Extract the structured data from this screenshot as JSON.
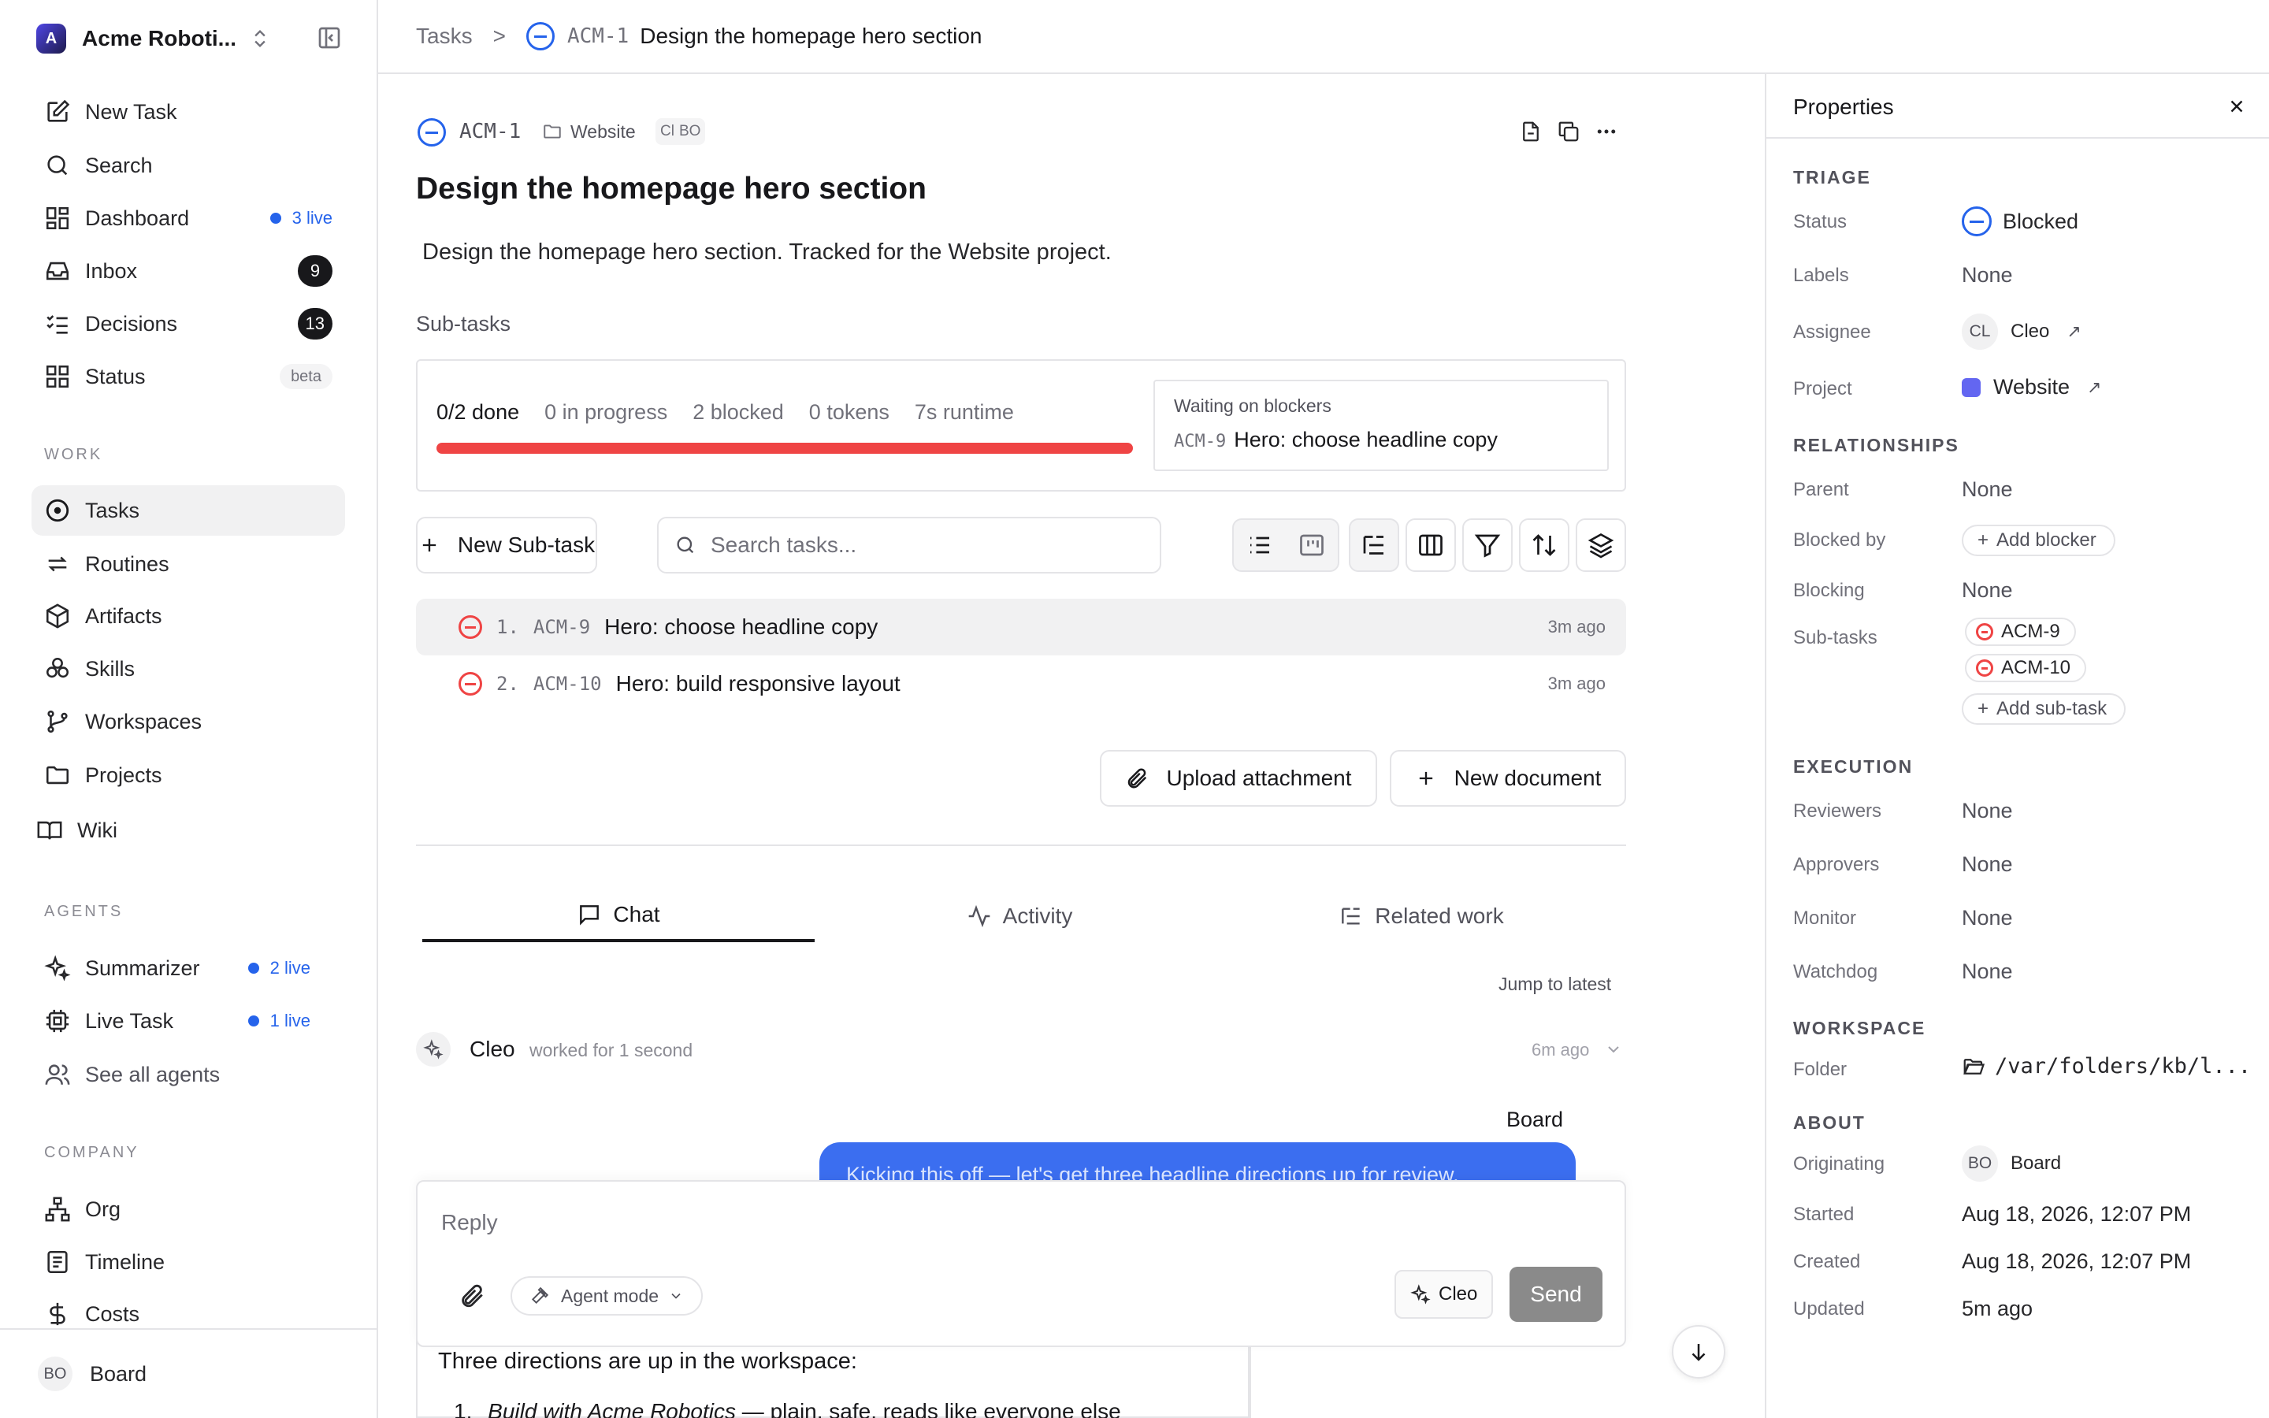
{
  "sidebar": {
    "workspace_initial": "A",
    "workspace_name": "Acme Roboti...",
    "items": [
      {
        "label": "New Task"
      },
      {
        "label": "Search"
      },
      {
        "label": "Dashboard",
        "live": "3 live"
      },
      {
        "label": "Inbox",
        "count": "9"
      },
      {
        "label": "Decisions",
        "count": "13"
      },
      {
        "label": "Status",
        "badge": "beta"
      }
    ],
    "work_label": "WORK",
    "work_items": [
      "Tasks",
      "Routines",
      "Artifacts",
      "Skills",
      "Workspaces",
      "Projects",
      "Wiki"
    ],
    "agents_label": "AGENTS",
    "agent_items": [
      {
        "label": "Summarizer",
        "live": "2 live"
      },
      {
        "label": "Live Task",
        "live": "1 live"
      },
      {
        "label": "See all agents"
      }
    ],
    "company_label": "COMPANY",
    "company_items": [
      "Org",
      "Timeline",
      "Costs"
    ],
    "user_initials": "BO",
    "user_name": "Board"
  },
  "breadcrumb": {
    "root": "Tasks",
    "sep": ">",
    "task_id": "ACM-1",
    "task_title": "Design the homepage hero section"
  },
  "task": {
    "id": "ACM-1",
    "project": "Website",
    "assignee_initials": "Cl",
    "owner_initials": "BO",
    "title": "Design the homepage hero section",
    "description": "Design the homepage hero section. Tracked for the Website project."
  },
  "subtasks": {
    "heading": "Sub-tasks",
    "stats": {
      "done": "0/2 done",
      "in_progress": "0 in progress",
      "blocked": "2 blocked",
      "tokens": "0 tokens",
      "runtime": "7s runtime"
    },
    "waiting_label": "Waiting on blockers",
    "waiting_id": "ACM-9",
    "waiting_title": "Hero: choose headline copy",
    "new_button": "New Sub-task",
    "search_placeholder": "Search tasks...",
    "rows": [
      {
        "num": "1.",
        "id": "ACM-9",
        "title": "Hero: choose headline copy",
        "ago": "3m ago"
      },
      {
        "num": "2.",
        "id": "ACM-10",
        "title": "Hero: build responsive layout",
        "ago": "3m ago"
      }
    ],
    "upload_button": "Upload attachment",
    "new_doc_button": "New document"
  },
  "tabs": [
    "Chat",
    "Activity",
    "Related work"
  ],
  "chat": {
    "jump_latest": "Jump to latest",
    "agent_name": "Cleo",
    "worked_for": "worked for 1 second",
    "time": "6m ago",
    "board_label": "Board",
    "bubble_text": "Kicking this off — let's get three headline directions up for review.",
    "reply_placeholder": "Reply",
    "agent_mode": "Agent mode",
    "agent_chip": "Cleo",
    "send": "Send",
    "below_text": "Three directions are up in the workspace:",
    "list_item_italic": "Build with Acme Robotics",
    "list_item_rest": " — plain, safe, reads like everyone else"
  },
  "props": {
    "title": "Properties",
    "triage": "TRIAGE",
    "status_key": "Status",
    "status_val": "Blocked",
    "labels_key": "Labels",
    "labels_val": "None",
    "assignee_key": "Assignee",
    "assignee_initials": "CL",
    "assignee_val": "Cleo",
    "project_key": "Project",
    "project_val": "Website",
    "relationships": "RELATIONSHIPS",
    "parent_key": "Parent",
    "parent_val": "None",
    "blocked_by_key": "Blocked by",
    "add_blocker": "Add blocker",
    "blocking_key": "Blocking",
    "blocking_val": "None",
    "subtasks_key": "Sub-tasks",
    "subtask_1": "ACM-9",
    "subtask_2": "ACM-10",
    "add_subtask": "Add sub-task",
    "execution": "EXECUTION",
    "reviewers_key": "Reviewers",
    "reviewers_val": "None",
    "approvers_key": "Approvers",
    "approvers_val": "None",
    "monitor_key": "Monitor",
    "monitor_val": "None",
    "watchdog_key": "Watchdog",
    "watchdog_val": "None",
    "workspace": "WORKSPACE",
    "folder_key": "Folder",
    "folder_val": "/var/folders/kb/l...",
    "about": "ABOUT",
    "originating_key": "Originating",
    "originating_initials": "BO",
    "originating_val": "Board",
    "started_key": "Started",
    "started_val": "Aug 18, 2026, 12:07 PM",
    "created_key": "Created",
    "created_val": "Aug 18, 2026, 12:07 PM",
    "updated_key": "Updated",
    "updated_val": "5m ago"
  },
  "colors": {
    "accent": "#2563eb",
    "blocked": "#ef4444",
    "project": "#6366f1",
    "bubble": "#3b6ef0"
  }
}
